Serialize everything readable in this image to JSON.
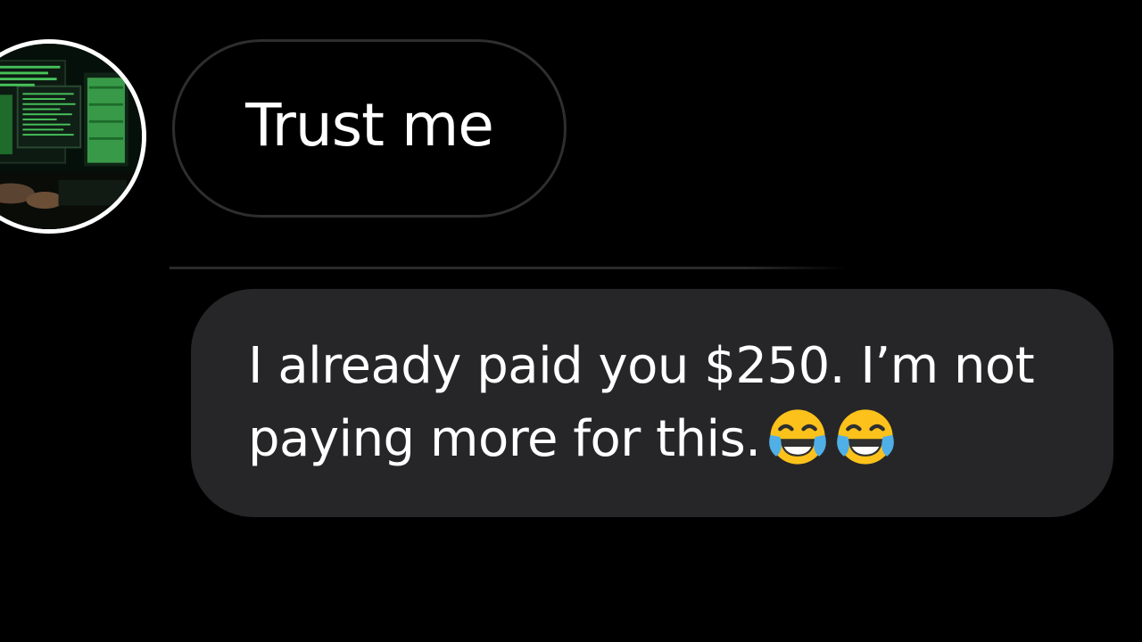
{
  "conversation": {
    "received_message": {
      "text": "Trust me"
    },
    "sent_message": {
      "text": "I already paid you $250. I’m not paying more for this.",
      "emojis": [
        "face-with-tears-of-joy-icon",
        "face-with-tears-of-joy-icon"
      ]
    }
  },
  "colors": {
    "background": "#000000",
    "sent_bubble": "#262628",
    "received_bubble_border": "#2e2e2e",
    "text": "#ffffff",
    "avatar_border": "#ffffff"
  }
}
